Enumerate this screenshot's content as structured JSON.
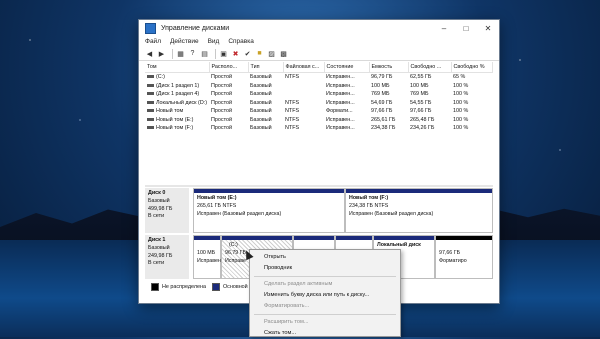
{
  "window": {
    "title": "Управление дисками"
  },
  "menu": [
    "Файл",
    "Действие",
    "Вид",
    "Справка"
  ],
  "table": {
    "columns": [
      "Том",
      "Располо...",
      "Тип",
      "Файловая с...",
      "Состояние",
      "Емкость",
      "Свободно ...",
      "Свободно %"
    ],
    "rows": [
      [
        "(C:)",
        "Простой",
        "Базовый",
        "NTFS",
        "Исправен...",
        "96,79 ГБ",
        "62,55 ГБ",
        "65 %"
      ],
      [
        "(Диск 1 раздел 1)",
        "Простой",
        "Базовый",
        "",
        "Исправен...",
        "100 МБ",
        "100 МБ",
        "100 %"
      ],
      [
        "(Диск 1 раздел 4)",
        "Простой",
        "Базовый",
        "",
        "Исправен...",
        "769 МБ",
        "769 МБ",
        "100 %"
      ],
      [
        "Локальный диск (D:)",
        "Простой",
        "Базовый",
        "NTFS",
        "Исправен...",
        "54,69 ГБ",
        "54,55 ГБ",
        "100 %"
      ],
      [
        "Новый том",
        "Простой",
        "Базовый",
        "NTFS",
        "Формати...",
        "97,66 ГБ",
        "97,66 ГБ",
        "100 %"
      ],
      [
        "Новый том (E:)",
        "Простой",
        "Базовый",
        "NTFS",
        "Исправен...",
        "265,61 ГБ",
        "265,48 ГБ",
        "100 %"
      ],
      [
        "Новый том (F:)",
        "Простой",
        "Базовый",
        "NTFS",
        "Исправен...",
        "234,38 ГБ",
        "234,26 ГБ",
        "100 %"
      ]
    ]
  },
  "disk0": {
    "name": "Диск 0",
    "type": "Базовый",
    "size": "499,98 ГБ",
    "status": "В сети",
    "parts": [
      {
        "title": "Новый том (E:)",
        "size": "265,61 ГБ NTFS",
        "status": "Исправен (Базовый раздел диска)"
      },
      {
        "title": "Новый том (F:)",
        "size": "234,38 ГБ NTFS",
        "status": "Исправен (Базовый раздел диска)"
      }
    ]
  },
  "disk1": {
    "name": "Диск 1",
    "type": "Базовый",
    "size": "249,98 ГБ",
    "status": "В сети",
    "parts": [
      {
        "title": "",
        "size": "100 МБ",
        "status": "Исправен"
      },
      {
        "title": "(C:)",
        "size": "96,79 ГБ",
        "status": "Исправе"
      },
      {
        "title": "",
        "size": "",
        "status": ""
      },
      {
        "title": "",
        "size": "",
        "status": ""
      },
      {
        "title": "Локальный диск (D:)",
        "size": "",
        "status": ""
      },
      {
        "title": "",
        "size": "97,66 ГБ",
        "status": "Форматиро"
      }
    ]
  },
  "legend": {
    "unallocated": "Не распределена",
    "primary": "Основной раздел"
  },
  "context_menu": {
    "items": [
      {
        "label": "Открыть",
        "disabled": false
      },
      {
        "label": "Проводник",
        "disabled": false
      },
      {
        "label": "Сделать раздел активным",
        "disabled": true
      },
      {
        "label": "Изменить букву диска или путь к диску...",
        "disabled": false
      },
      {
        "label": "Форматировать...",
        "disabled": true
      },
      {
        "label": "Расширить том...",
        "disabled": true
      },
      {
        "label": "Сжать том...",
        "disabled": false
      }
    ]
  },
  "colors": {
    "primary_partition": "#1b2a7a",
    "unallocated": "#000000"
  }
}
